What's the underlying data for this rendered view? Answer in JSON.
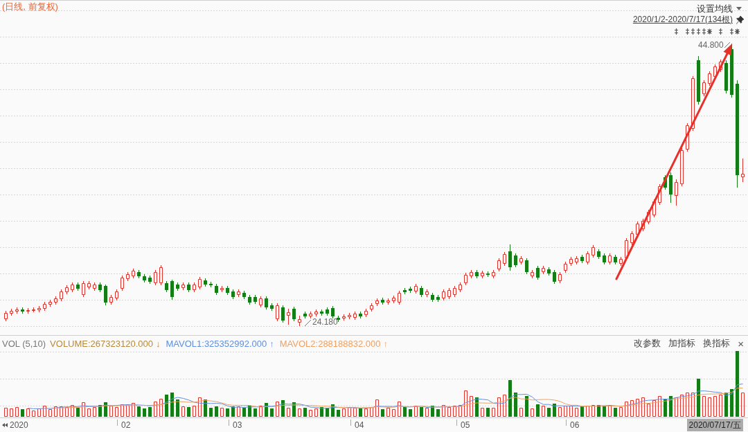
{
  "chart_header": {
    "title": "(日线, 前复权)",
    "ma_settings": "设置均线",
    "range": "2020/1/2-2020/7/17(134根)"
  },
  "price_panel": {
    "high_label": "44.800",
    "low_label": "24.180"
  },
  "volume_panel": {
    "indicator": "VOL (5,10)",
    "readings": [
      {
        "text": "VOLUME:267323120.000",
        "arrow": "↓",
        "color": "#b8893a"
      },
      {
        "text": "MAVOL1:325352992.000",
        "arrow": "↑",
        "color": "#5b90e0"
      },
      {
        "text": "MAVOL2:288188832.000",
        "arrow": "↑",
        "color": "#f0a060"
      }
    ],
    "actions": [
      "改参数",
      "加指标",
      "换指标"
    ],
    "close": "×"
  },
  "x_axis": {
    "labels": [
      "2020",
      "02",
      "03",
      "04",
      "05",
      "06"
    ],
    "cursor_date": "2020/07/17/五"
  }
}
